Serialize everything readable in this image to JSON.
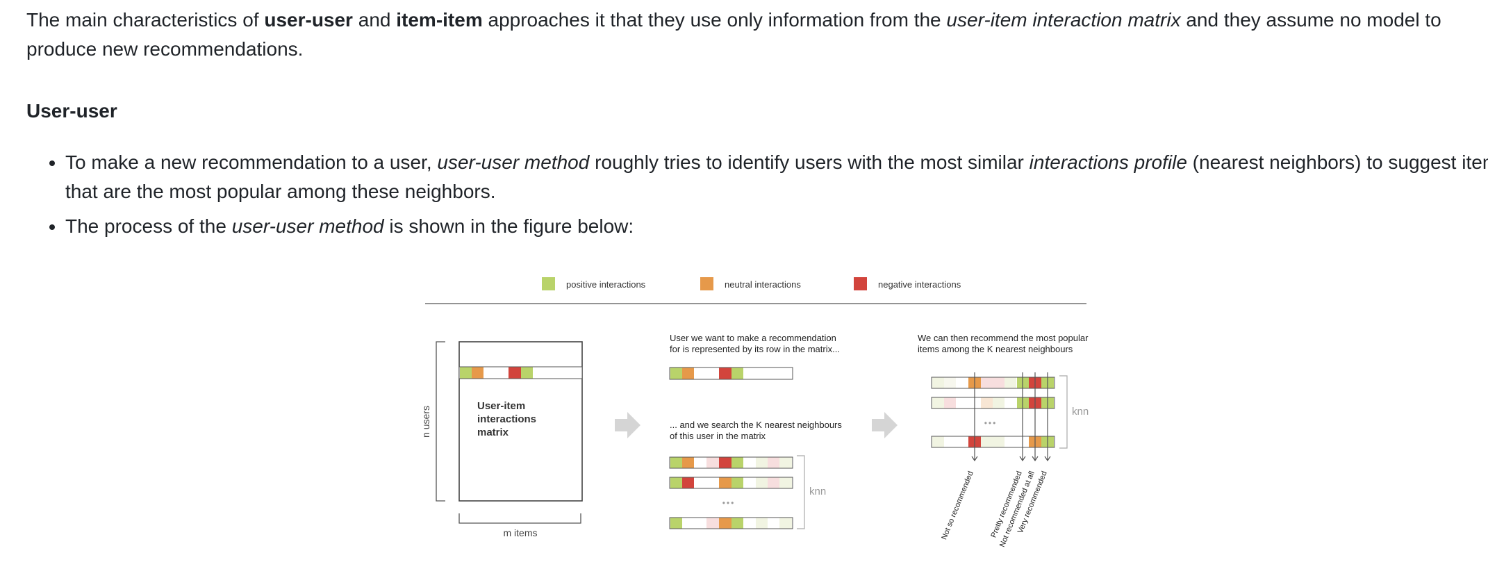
{
  "intro": {
    "p1": "The main characteristics of ",
    "b1": "user-user",
    "p2": " and ",
    "b2": "item-item",
    "p3": " approaches it that they use only information from the ",
    "i1": "user-item interaction matrix",
    "p4": " and they assume no model to produce new recommendations."
  },
  "section_heading": "User-user",
  "bullets": [
    {
      "t1": "To make a new recommendation to a user, ",
      "i1": "user-user method",
      "t2": " roughly tries to identify users with the most similar ",
      "i2": "interactions profile",
      "t3": " (nearest neighbors) to suggest items that are the most popular among these neighbors."
    },
    {
      "t1": "The process of the ",
      "i1": "user-user method",
      "t2": " is shown in the figure below:"
    }
  ],
  "figure": {
    "legend": {
      "positive": "positive interactions",
      "neutral": "neutral interactions",
      "negative": "negative interactions"
    },
    "colors": {
      "positive": "#b9d36a",
      "neutral": "#e6994a",
      "negative": "#d2443c",
      "positive_light": "#f1f4e2",
      "negative_light": "#f7dede",
      "neutral_light": "#f8e6d4",
      "line": "#555555"
    },
    "matrix": {
      "title_lines": [
        "User-item",
        "interactions",
        "matrix"
      ],
      "n_users": "n users",
      "m_items": "m items"
    },
    "middle": {
      "caption_top": [
        "User we want to make a recommendation",
        "for is represented by its row in the matrix..."
      ],
      "caption_bottom": [
        "... and we search the K nearest neighbours",
        "of this user in the matrix"
      ],
      "knn": "knn",
      "dots": "•••"
    },
    "right": {
      "caption": [
        "We can then recommend the most popular",
        "items among the K nearest neighbours"
      ],
      "knn": "knn",
      "dots": "•••",
      "labels": [
        "Not so recommended",
        "Pretty recommended",
        "Not recommended at all",
        "Very recommended"
      ]
    }
  }
}
